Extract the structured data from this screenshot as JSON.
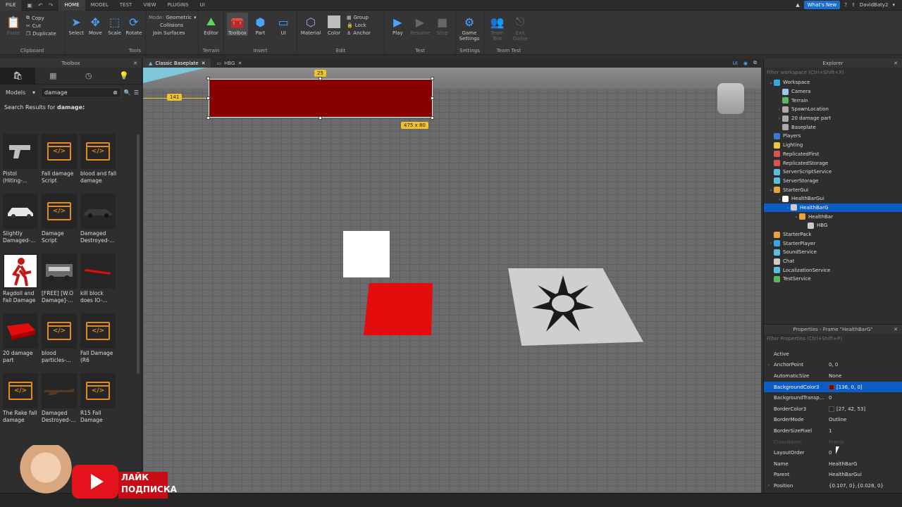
{
  "menubar": {
    "file": "FILE",
    "tabs": [
      "HOME",
      "MODEL",
      "TEST",
      "VIEW",
      "PLUGINS",
      "UI"
    ],
    "whats_new": "What's New",
    "user": "DavidBaty2"
  },
  "ribbon": {
    "clipboard": {
      "paste": "Paste",
      "copy": "Copy",
      "cut": "Cut",
      "duplicate": "Duplicate",
      "label": "Clipboard"
    },
    "tools": {
      "select": "Select",
      "move": "Move",
      "scale": "Scale",
      "rotate": "Rotate",
      "label": "Tools"
    },
    "mode": {
      "label": "Mode:",
      "value": "Geometric",
      "collisions": "Collisions",
      "join": "Join Surfaces"
    },
    "terrain": {
      "editor": "Editor",
      "label": "Terrain"
    },
    "insert": {
      "toolbox": "Toolbox",
      "part": "Part",
      "ui": "UI",
      "label": "Insert"
    },
    "edit": {
      "material": "Material",
      "color": "Color",
      "group": "Group",
      "lock": "Lock",
      "anchor": "Anchor",
      "label": "Edit"
    },
    "test": {
      "play": "Play",
      "resume": "Resume",
      "stop": "Stop",
      "label": "Test"
    },
    "settings": {
      "game_settings_1": "Game",
      "game_settings_2": "Settings",
      "label": "Settings"
    },
    "team_test": {
      "team_test_1": "Team",
      "team_test_2": "Test",
      "exit_1": "Exit",
      "exit_2": "Game",
      "label": "Team Test"
    }
  },
  "toolbox": {
    "title": "Toolbox",
    "category": "Models",
    "search_value": "damage",
    "results_prefix": "Search Results for ",
    "results_query": "damage:",
    "items": [
      {
        "label": "Pistol (Hiting-...",
        "thumb": "pistol"
      },
      {
        "label": "Fall damage Script",
        "thumb": "script"
      },
      {
        "label": "blood and fall damage",
        "thumb": "script"
      },
      {
        "label": "Slightly Damaged-...",
        "thumb": "car-white"
      },
      {
        "label": "Damage Script",
        "thumb": "script"
      },
      {
        "label": "Damaged Destroyed-...",
        "thumb": "car-dark"
      },
      {
        "label": "Ragdoll and Fall Damage",
        "thumb": "ragdoll"
      },
      {
        "label": "[FREE] [W.O Damage]-...",
        "thumb": "truck"
      },
      {
        "label": "kill block does IO-...",
        "thumb": "red-bar"
      },
      {
        "label": "20 damage part",
        "thumb": "red-part"
      },
      {
        "label": "blood particles-...",
        "thumb": "script"
      },
      {
        "label": "Fall Damage (R6",
        "thumb": "script"
      },
      {
        "label": "The Rake fall damage",
        "thumb": "script"
      },
      {
        "label": "Damaged Destroyed-...",
        "thumb": "rifle"
      },
      {
        "label": "R15 Fall Damage",
        "thumb": "script"
      }
    ]
  },
  "doctabs": [
    {
      "label": "Classic Baseplate",
      "active": true
    },
    {
      "label": "HBG",
      "active": false
    }
  ],
  "viewport": {
    "badge_top": "25",
    "badge_left": "141",
    "badge_size": "475 x 80",
    "ui_toggle": "UI"
  },
  "explorer": {
    "title": "Explorer",
    "filter": "Filter workspace (Ctrl+Shift+X)",
    "rows": [
      {
        "label": "Workspace",
        "depth": 0,
        "arrow": "v",
        "color": "#3aa7e0"
      },
      {
        "label": "Camera",
        "depth": 1,
        "arrow": "",
        "color": "#9cc5e8"
      },
      {
        "label": "Terrain",
        "depth": 1,
        "arrow": "",
        "color": "#5cb85c"
      },
      {
        "label": "SpawnLocation",
        "depth": 1,
        "arrow": ">",
        "color": "#aaaaaa"
      },
      {
        "label": "20 damage part",
        "depth": 1,
        "arrow": ">",
        "color": "#aaaaaa"
      },
      {
        "label": "Baseplate",
        "depth": 1,
        "arrow": "",
        "color": "#aaaaaa"
      },
      {
        "label": "Players",
        "depth": 0,
        "arrow": "",
        "color": "#3a7ad1"
      },
      {
        "label": "Lighting",
        "depth": 0,
        "arrow": "",
        "color": "#e8c73a"
      },
      {
        "label": "ReplicatedFirst",
        "depth": 0,
        "arrow": "",
        "color": "#d9534f"
      },
      {
        "label": "ReplicatedStorage",
        "depth": 0,
        "arrow": "",
        "color": "#d9534f"
      },
      {
        "label": "ServerScriptService",
        "depth": 0,
        "arrow": "",
        "color": "#5bc0de"
      },
      {
        "label": "ServerStorage",
        "depth": 0,
        "arrow": "",
        "color": "#5bc0de"
      },
      {
        "label": "StarterGui",
        "depth": 0,
        "arrow": "v",
        "color": "#e8a33a"
      },
      {
        "label": "HealthBarGui",
        "depth": 1,
        "arrow": "v",
        "color": "#ffffff"
      },
      {
        "label": "HealthBarG",
        "depth": 2,
        "arrow": "v",
        "color": "#cccccc",
        "selected": true
      },
      {
        "label": "HealthBar",
        "depth": 3,
        "arrow": "v",
        "color": "#e8a33a"
      },
      {
        "label": "HBG",
        "depth": 4,
        "arrow": "",
        "color": "#cccccc"
      },
      {
        "label": "StarterPack",
        "depth": 0,
        "arrow": "",
        "color": "#e8a33a"
      },
      {
        "label": "StarterPlayer",
        "depth": 0,
        "arrow": ">",
        "color": "#3aa7e0"
      },
      {
        "label": "SoundService",
        "depth": 0,
        "arrow": "",
        "color": "#5bc0de"
      },
      {
        "label": "Chat",
        "depth": 0,
        "arrow": "",
        "color": "#cccccc"
      },
      {
        "label": "LocalizationService",
        "depth": 0,
        "arrow": "",
        "color": "#5bc0de"
      },
      {
        "label": "TestService",
        "depth": 0,
        "arrow": "",
        "color": "#5cb85c"
      }
    ]
  },
  "properties": {
    "title": "Properties - Frame \"HealthBarG\"",
    "filter": "Filter Properties (Ctrl+Shift+P)",
    "rows": [
      {
        "name": "Active",
        "value": "",
        "expand": false,
        "swatch": ""
      },
      {
        "name": "AnchorPoint",
        "value": "0, 0",
        "expand": true,
        "swatch": ""
      },
      {
        "name": "AutomaticSize",
        "value": "None",
        "expand": false,
        "swatch": ""
      },
      {
        "name": "BackgroundColor3",
        "value": "[136, 0, 0]",
        "expand": false,
        "swatch": "#880000",
        "selected": true
      },
      {
        "name": "BackgroundTransp...",
        "value": "0",
        "expand": false,
        "swatch": ""
      },
      {
        "name": "BorderColor3",
        "value": "[27, 42, 53]",
        "expand": false,
        "swatch": "#1b2a35"
      },
      {
        "name": "BorderMode",
        "value": "Outline",
        "expand": false,
        "swatch": ""
      },
      {
        "name": "BorderSizePixel",
        "value": "1",
        "expand": false,
        "swatch": ""
      },
      {
        "name": "ClassName",
        "value": "Frame",
        "expand": false,
        "swatch": "",
        "dim": true
      },
      {
        "name": "LayoutOrder",
        "value": "0",
        "expand": false,
        "swatch": ""
      },
      {
        "name": "Name",
        "value": "HealthBarG",
        "expand": false,
        "swatch": ""
      },
      {
        "name": "Parent",
        "value": "HealthBarGui",
        "expand": false,
        "swatch": ""
      },
      {
        "name": "Position",
        "value": "{0.107, 0},{0.028, 0}",
        "expand": true,
        "swatch": ""
      }
    ]
  },
  "overlay": {
    "sub_line1": "ЛАЙК",
    "sub_line2": "ПОДПИСКА"
  }
}
